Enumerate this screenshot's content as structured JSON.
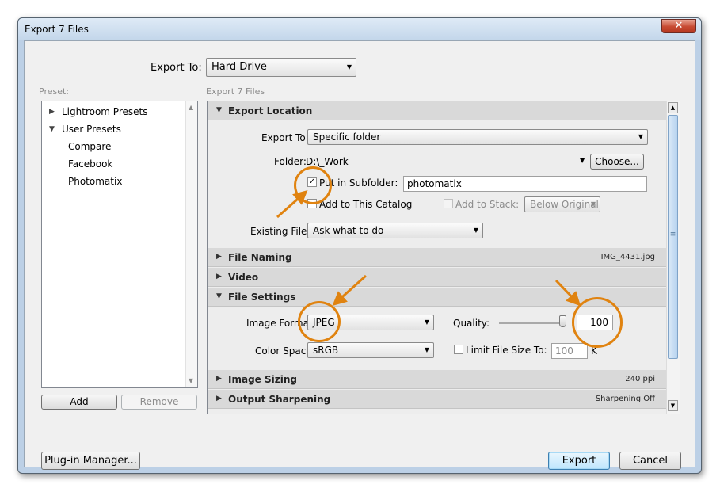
{
  "window": {
    "title": "Export 7 Files",
    "close_glyph": "✕"
  },
  "export_to": {
    "label": "Export To:",
    "value": "Hard Drive"
  },
  "preset": {
    "label": "Preset:",
    "groups": [
      {
        "label": "Lightroom Presets",
        "expanded": false
      },
      {
        "label": "User Presets",
        "expanded": true
      }
    ],
    "items": [
      "Compare",
      "Facebook",
      "Photomatix"
    ],
    "add_label": "Add",
    "remove_label": "Remove"
  },
  "panel": {
    "heading": "Export 7 Files",
    "export_location": {
      "title": "Export Location",
      "export_to_label": "Export To:",
      "export_to_value": "Specific folder",
      "folder_label": "Folder:",
      "folder_value": "D:\\_Work",
      "choose_label": "Choose...",
      "subfolder_label": "Put in Subfolder:",
      "subfolder_checked": true,
      "subfolder_value": "photomatix",
      "catalog_label": "Add to This Catalog",
      "stack_label": "Add to Stack:",
      "stack_value": "Below Original",
      "existing_label": "Existing Files:",
      "existing_value": "Ask what to do"
    },
    "file_naming": {
      "title": "File Naming",
      "summary": "IMG_4431.jpg"
    },
    "video": {
      "title": "Video"
    },
    "file_settings": {
      "title": "File Settings",
      "format_label": "Image Format:",
      "format_value": "JPEG",
      "quality_label": "Quality:",
      "quality_value": "100",
      "quality_level": 1.0,
      "colorspace_label": "Color Space:",
      "colorspace_value": "sRGB",
      "limit_label": "Limit File Size To:",
      "limit_value": "100",
      "limit_unit": "K"
    },
    "image_sizing": {
      "title": "Image Sizing",
      "summary": "240 ppi"
    },
    "output_sharpening": {
      "title": "Output Sharpening",
      "summary": "Sharpening Off"
    }
  },
  "footer": {
    "plugin_label": "Plug-in Manager...",
    "export_label": "Export",
    "cancel_label": "Cancel"
  },
  "colors": {
    "annotation": "#e08310",
    "title_bar": "#c3d6ea",
    "close": "#c74a32"
  }
}
